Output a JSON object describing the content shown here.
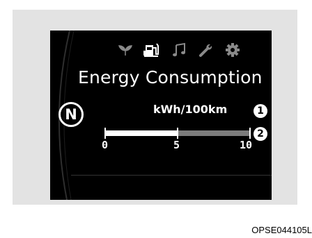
{
  "display": {
    "title": "Energy Consumption",
    "gear_position": "N",
    "unit": "kWh/100km",
    "callouts": [
      "1",
      "2"
    ],
    "gauge": {
      "fill_value": 5,
      "min": 0,
      "max": 10,
      "tick_labels": [
        "0",
        "5",
        "10"
      ]
    },
    "menu_icons": [
      {
        "name": "eco-leaf-icon",
        "active": false
      },
      {
        "name": "fuel-charge-icon",
        "active": true
      },
      {
        "name": "music-note-icon",
        "active": false
      },
      {
        "name": "wrench-icon",
        "active": false
      },
      {
        "name": "gear-settings-icon",
        "active": false
      }
    ],
    "colors": {
      "background": "#000000",
      "foreground": "#ffffff",
      "inactive_icon": "#8a8a8a",
      "bar_track": "#7c7c7c"
    }
  },
  "caption": "OPSE044105L"
}
